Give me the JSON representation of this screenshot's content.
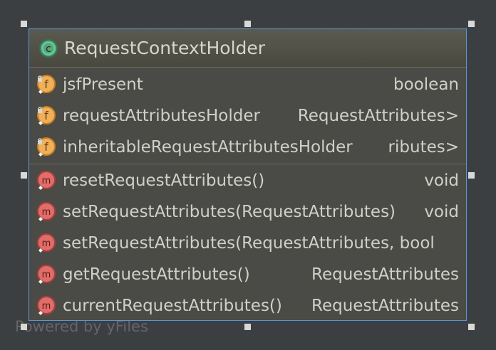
{
  "diagram": {
    "class_name": "RequestContextHolder",
    "watermark": "Powered by yFiles",
    "fields": [
      {
        "name": "jsfPresent",
        "type": "boolean"
      },
      {
        "name": "requestAttributesHolder",
        "type": "RequestAttributes>"
      },
      {
        "name": "inheritableRequestAttributesHolder",
        "type": "ributes>"
      }
    ],
    "methods": [
      {
        "name": "resetRequestAttributes()",
        "type": "void"
      },
      {
        "name": "setRequestAttributes(RequestAttributes)",
        "type": "void"
      },
      {
        "name": "setRequestAttributes(RequestAttributes, bool",
        "type": ""
      },
      {
        "name": "getRequestAttributes()",
        "type": "RequestAttributes"
      },
      {
        "name": "currentRequestAttributes()",
        "type": "RequestAttributes"
      }
    ],
    "icons": {
      "class": "class-icon",
      "field": "field-icon",
      "method": "method-icon",
      "lock": "lock-icon",
      "visibility": "visibility-icon"
    },
    "colors": {
      "background": "#3c3f41",
      "node_fill": "#4a4b46",
      "node_border": "#5b95d8",
      "class_icon": "#58a869",
      "field_icon": "#f0b05a",
      "method_icon": "#df6d69"
    }
  }
}
